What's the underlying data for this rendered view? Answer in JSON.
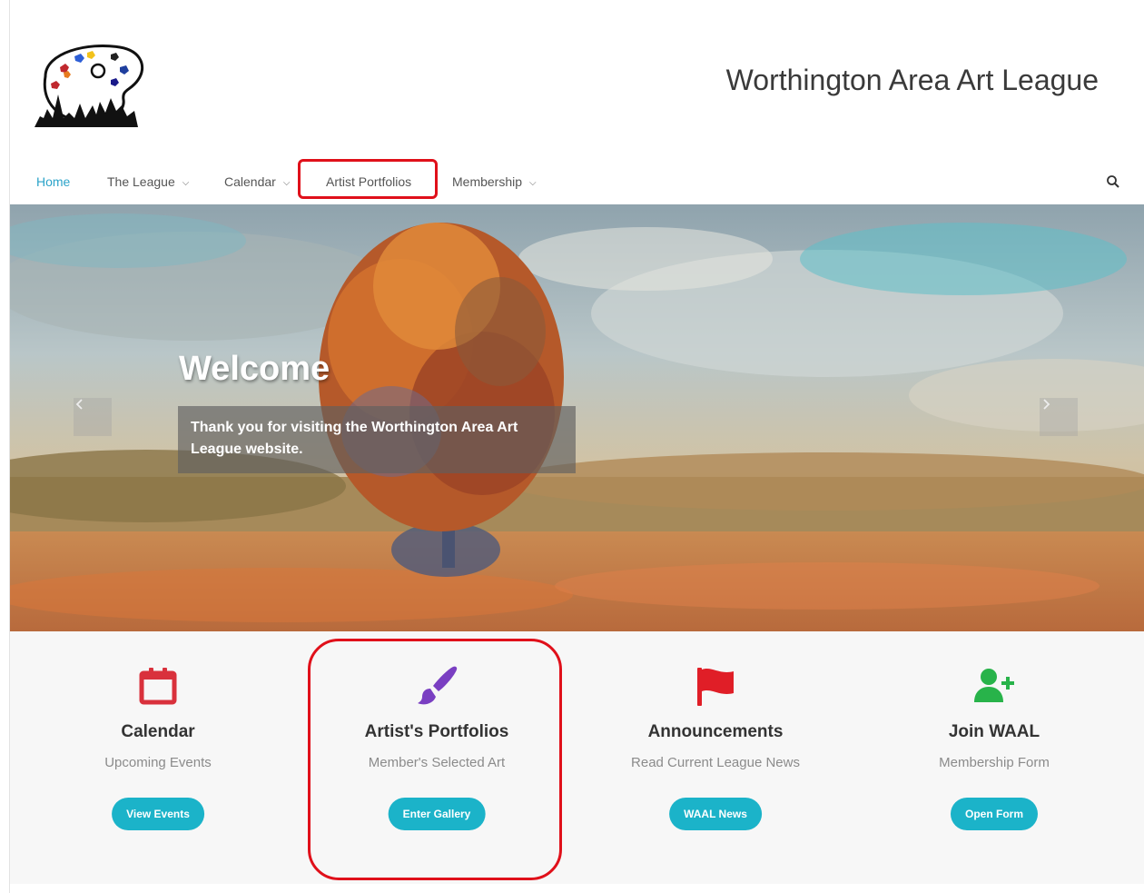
{
  "site": {
    "title": "Worthington Area Art League"
  },
  "nav": {
    "items": [
      {
        "label": "Home",
        "active": true,
        "dropdown": false
      },
      {
        "label": "The League",
        "active": false,
        "dropdown": true
      },
      {
        "label": "Calendar",
        "active": false,
        "dropdown": true
      },
      {
        "label": "Artist Portfolios",
        "active": false,
        "dropdown": false,
        "highlighted": true
      },
      {
        "label": "Membership",
        "active": false,
        "dropdown": true
      }
    ],
    "search_icon": "search-icon"
  },
  "hero": {
    "title": "Welcome",
    "caption": "Thank you for visiting the Worthington Area Art League website."
  },
  "features": [
    {
      "icon": "calendar-icon",
      "color": "#d9313c",
      "title": "Calendar",
      "subtitle": "Upcoming Events",
      "button": "View Events"
    },
    {
      "icon": "paintbrush-icon",
      "color": "#7a3fc2",
      "title": "Artist's Portfolios",
      "subtitle": "Member's Selected Art",
      "button": "Enter Gallery",
      "highlighted": true
    },
    {
      "icon": "flag-icon",
      "color": "#e01e27",
      "title": "Announcements",
      "subtitle": "Read Current League News",
      "button": "WAAL News"
    },
    {
      "icon": "user-plus-icon",
      "color": "#28b34a",
      "title": "Join WAAL",
      "subtitle": "Membership Form",
      "button": "Open Form"
    }
  ],
  "colors": {
    "accent": "#2ba3c9",
    "button": "#1bb3c9",
    "highlight": "#e0101a"
  }
}
